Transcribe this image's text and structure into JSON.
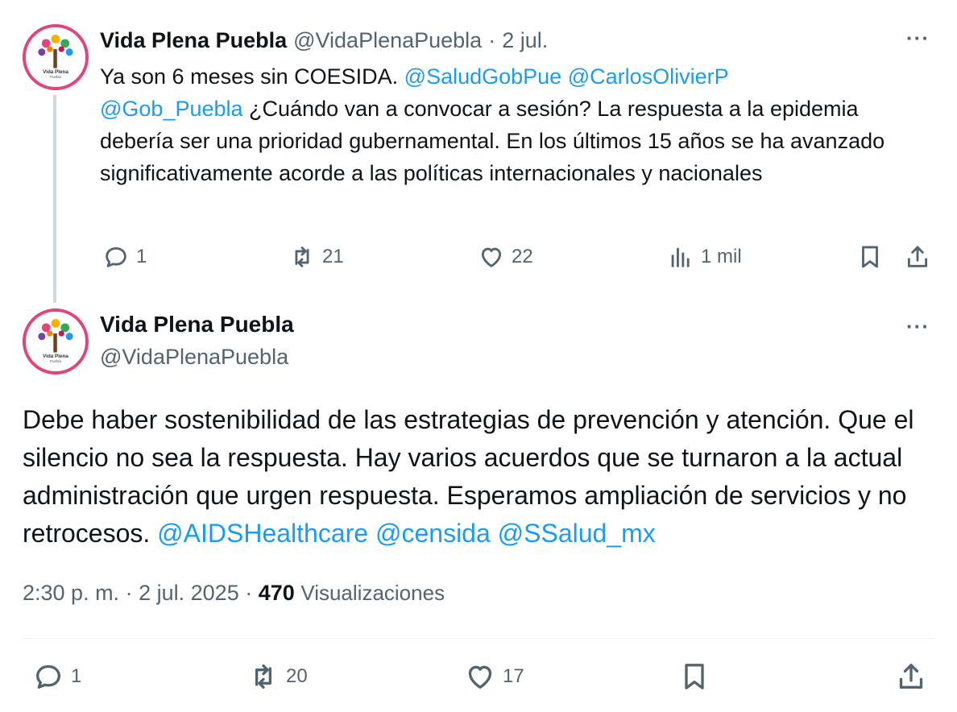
{
  "colors": {
    "accent": "#1d9bf0",
    "muted": "#536471",
    "text": "#0f1419",
    "avatar_border": "#e0457b"
  },
  "tweet1": {
    "avatar_label": "Vida Plena",
    "avatar_sublabel": "Puebla",
    "display_name": "Vida Plena Puebla",
    "handle": "@VidaPlenaPuebla",
    "separator": "·",
    "date": "2 jul.",
    "more_icon": "more-dots-icon",
    "body_line1_text": "Ya son 6 meses sin COESIDA. ",
    "mention1": "@SaludGobPue",
    "mention2": "@CarlosOlivierP",
    "mention3": "@Gob_Puebla",
    "body_rest": " ¿Cuándo van a convocar a sesión? La respuesta a la epidemia debería ser una prioridad gubernamental. En los últimos 15 años se ha avanzado significativamente acorde a las políticas internacionales y nacionales",
    "replies": "1",
    "retweets": "21",
    "likes": "22",
    "views": "1 mil"
  },
  "tweet2": {
    "avatar_label": "Vida Plena",
    "avatar_sublabel": "Puebla",
    "display_name": "Vida Plena Puebla",
    "handle": "@VidaPlenaPuebla",
    "more_icon": "more-dots-icon",
    "body_text": "Debe haber sostenibilidad de las estrategias de prevención y atención. Que el silencio no sea la respuesta. Hay varios acuerdos que se turnaron a la actual administración que urgen respuesta. Esperamos ampliación de  servicios y no retrocesos. ",
    "mention1": "@AIDSHealthcare",
    "mention2": "@censida",
    "mention3": "@SSalud_mx",
    "time": "2:30 p. m.",
    "sep1": "·",
    "date": "2 jul. 2025",
    "sep2": "·",
    "views_count": "470",
    "views_label": "Visualizaciones",
    "replies": "1",
    "retweets": "20",
    "likes": "17"
  }
}
